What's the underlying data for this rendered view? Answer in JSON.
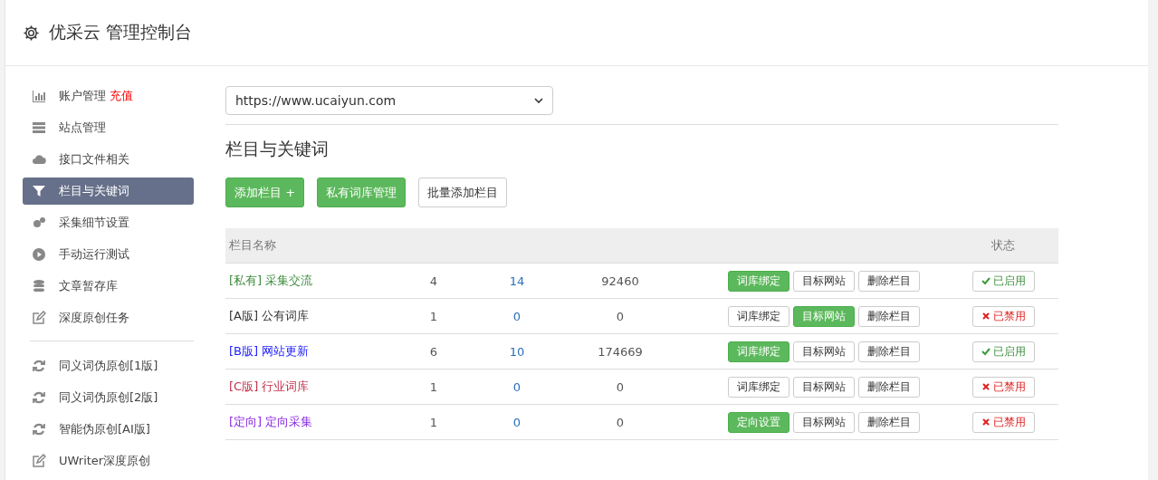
{
  "header": {
    "title": "优采云 管理控制台"
  },
  "sidebar": {
    "groups": [
      {
        "items": [
          {
            "label": "账户管理",
            "extra": "充值",
            "selected": false
          },
          {
            "label": "站点管理",
            "selected": false
          },
          {
            "label": "接口文件相关",
            "selected": false
          },
          {
            "label": "栏目与关键词",
            "selected": true
          },
          {
            "label": "采集细节设置",
            "selected": false
          },
          {
            "label": "手动运行测试",
            "selected": false
          },
          {
            "label": "文章暂存库",
            "selected": false
          },
          {
            "label": "深度原创任务",
            "selected": false
          }
        ]
      },
      {
        "items": [
          {
            "label": "同义词伪原创[1版]",
            "selected": false
          },
          {
            "label": "同义词伪原创[2版]",
            "selected": false
          },
          {
            "label": "智能伪原创[AI版]",
            "selected": false
          },
          {
            "label": "UWriter深度原创",
            "selected": false
          }
        ]
      }
    ]
  },
  "site_select": {
    "value": "https://www.ucaiyun.com"
  },
  "section_title": "栏目与关键词",
  "toolbar": [
    {
      "label": "添加栏目 +",
      "primary": true
    },
    {
      "label": "私有词库管理",
      "primary": true
    },
    {
      "label": "批量添加栏目",
      "primary": false
    }
  ],
  "table": {
    "columns": [
      "栏目名称",
      "状态"
    ],
    "rows": [
      {
        "tag": "[私有]",
        "name": "采集交流",
        "color": "#3d8b3d",
        "c2": "4",
        "c3": "14",
        "c4": "92460",
        "ops": [
          {
            "label": "词库绑定",
            "primary": true
          },
          {
            "label": "目标网站",
            "primary": false
          },
          {
            "label": "删除栏目",
            "primary": false
          }
        ],
        "status": "已启用",
        "enabled": true
      },
      {
        "tag": "[A版]",
        "name": "公有词库",
        "color": "#333333",
        "c2": "1",
        "c3": "0",
        "c4": "0",
        "ops": [
          {
            "label": "词库绑定",
            "primary": false
          },
          {
            "label": "目标网站",
            "primary": true
          },
          {
            "label": "删除栏目",
            "primary": false
          }
        ],
        "status": "已禁用",
        "enabled": false
      },
      {
        "tag": "[B版]",
        "name": "网站更新",
        "color": "#1a1aff",
        "c2": "6",
        "c3": "10",
        "c4": "174669",
        "ops": [
          {
            "label": "词库绑定",
            "primary": true
          },
          {
            "label": "目标网站",
            "primary": false
          },
          {
            "label": "删除栏目",
            "primary": false
          }
        ],
        "status": "已启用",
        "enabled": true
      },
      {
        "tag": "[C版]",
        "name": "行业词库",
        "color": "#c0304a",
        "c2": "1",
        "c3": "0",
        "c4": "0",
        "ops": [
          {
            "label": "词库绑定",
            "primary": false
          },
          {
            "label": "目标网站",
            "primary": false
          },
          {
            "label": "删除栏目",
            "primary": false
          }
        ],
        "status": "已禁用",
        "enabled": false
      },
      {
        "tag": "[定向]",
        "name": "定向采集",
        "color": "#8a2be2",
        "c2": "1",
        "c3": "0",
        "c4": "0",
        "ops": [
          {
            "label": "定向设置",
            "primary": true
          },
          {
            "label": "目标网站",
            "primary": false
          },
          {
            "label": "删除栏目",
            "primary": false
          }
        ],
        "status": "已禁用",
        "enabled": false
      }
    ]
  }
}
